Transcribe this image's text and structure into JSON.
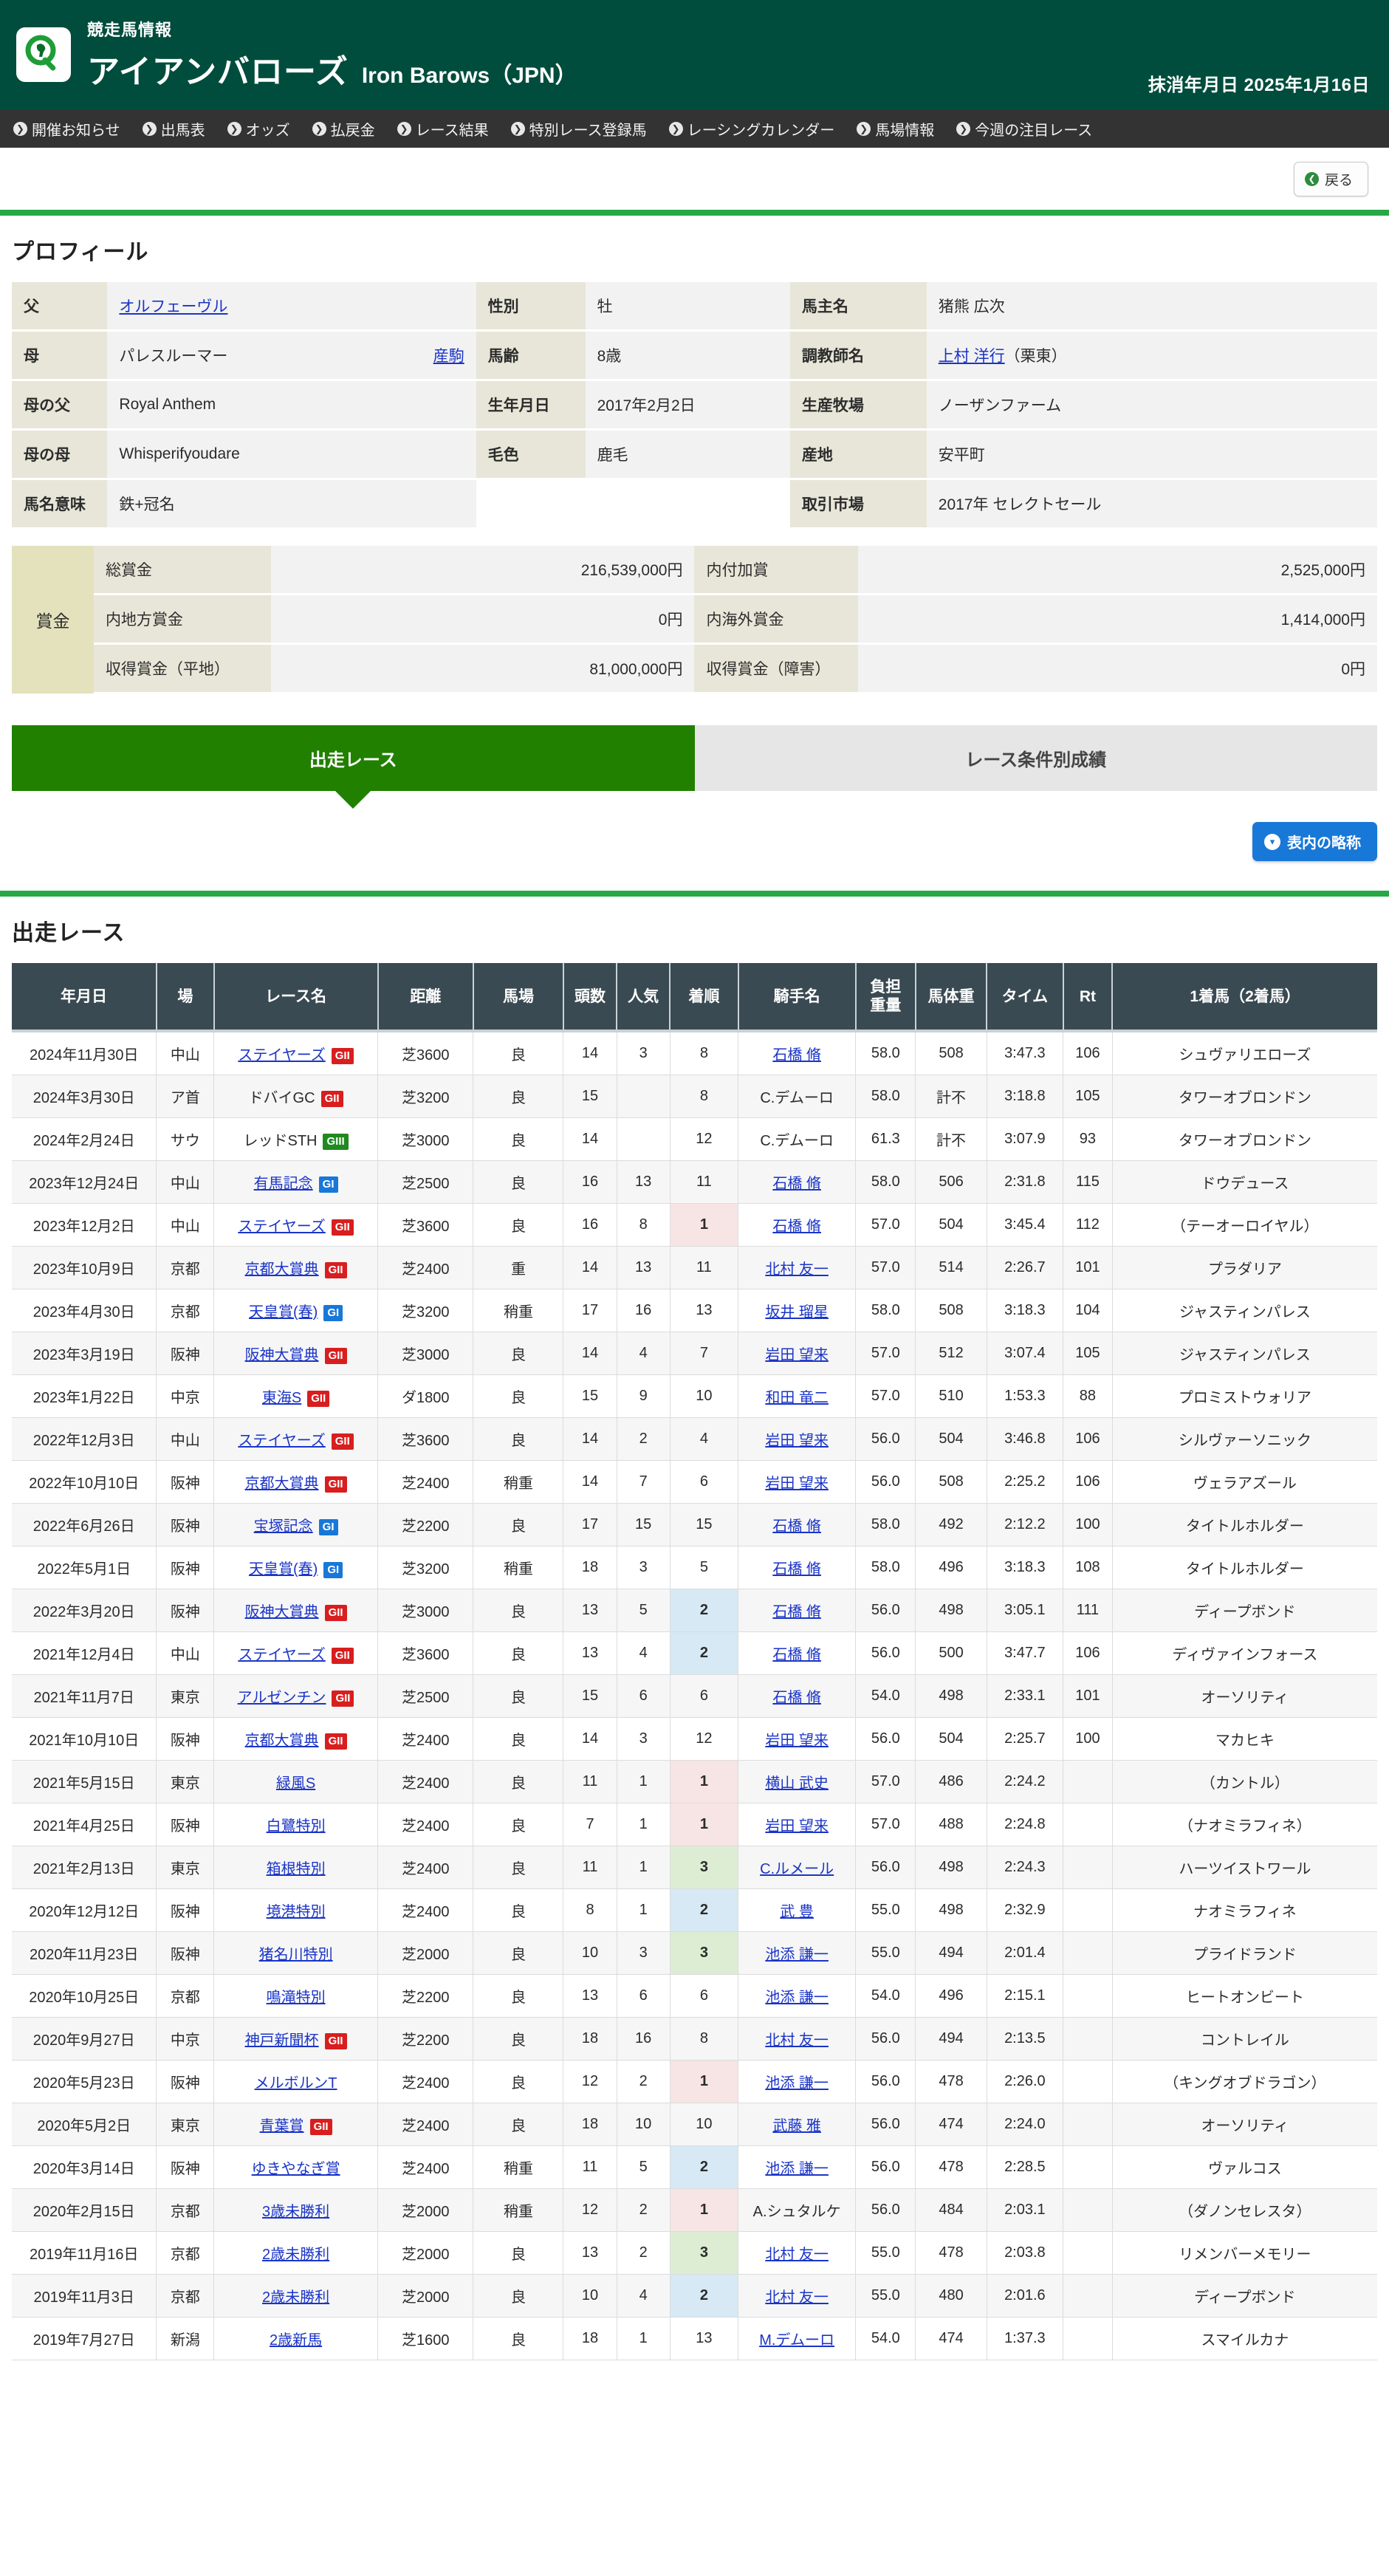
{
  "header": {
    "kicker": "競走馬情報",
    "horse_name_ja": "アイアンバローズ",
    "horse_name_en": "Iron Barows（JPN）",
    "erase_date": "抹消年月日 2025年1月16日",
    "logo_icon": "horse-magnifier-icon",
    "bg_color": "#004d3d"
  },
  "nav": {
    "items": [
      {
        "label": "開催お知らせ"
      },
      {
        "label": "出馬表"
      },
      {
        "label": "オッズ"
      },
      {
        "label": "払戻金"
      },
      {
        "label": "レース結果"
      },
      {
        "label": "特別レース登録馬"
      },
      {
        "label": "レーシングカレンダー"
      },
      {
        "label": "馬場情報"
      },
      {
        "label": "今週の注目レース"
      }
    ]
  },
  "back_button": {
    "label": "戻る",
    "icon": "back-arrow-icon"
  },
  "profile": {
    "section_title": "プロフィール",
    "rows": [
      {
        "l_label": "父",
        "l_value": "オルフェーヴル",
        "l_link": true,
        "l_sub": "",
        "r_label": "性別",
        "r_value": "牡",
        "x_label": "馬主名",
        "x_value": "猪熊 広次",
        "x_link": false,
        "x_suffix": ""
      },
      {
        "l_label": "母",
        "l_value": "パレスルーマー",
        "l_link": false,
        "l_sub": "産駒",
        "r_label": "馬齢",
        "r_value": "8歳",
        "x_label": "調教師名",
        "x_value": "上村 洋行",
        "x_link": true,
        "x_suffix": "（栗東）"
      },
      {
        "l_label": "母の父",
        "l_value": "Royal Anthem",
        "l_link": false,
        "l_sub": "",
        "r_label": "生年月日",
        "r_value": "2017年2月2日",
        "x_label": "生産牧場",
        "x_value": "ノーザンファーム",
        "x_link": false,
        "x_suffix": ""
      },
      {
        "l_label": "母の母",
        "l_value": "Whisperifyoudare",
        "l_link": false,
        "l_sub": "",
        "r_label": "毛色",
        "r_value": "鹿毛",
        "x_label": "産地",
        "x_value": "安平町",
        "x_link": false,
        "x_suffix": ""
      },
      {
        "l_label": "馬名意味",
        "l_value": "鉄+冠名",
        "l_link": false,
        "l_sub": "",
        "r_label": "",
        "r_value": "",
        "x_label": "取引市場",
        "x_value": "2017年 セレクトセール",
        "x_link": false,
        "x_suffix": ""
      }
    ]
  },
  "prize": {
    "head_label": "賞金",
    "rows": [
      {
        "l_label": "総賞金",
        "l_value": "216,539,000円",
        "r_label": "内付加賞",
        "r_value": "2,525,000円"
      },
      {
        "l_label": "内地方賞金",
        "l_value": "0円",
        "r_label": "内海外賞金",
        "r_value": "1,414,000円"
      },
      {
        "l_label": "収得賞金（平地）",
        "l_value": "81,000,000円",
        "r_label": "収得賞金（障害）",
        "r_value": "0円"
      }
    ]
  },
  "tabs": {
    "active": "出走レース",
    "inactive": "レース条件別成績"
  },
  "abbrev_button": {
    "label": "表内の略称",
    "icon": "chevron-down-circle-icon"
  },
  "race_section": {
    "title": "出走レース",
    "columns": [
      "年月日",
      "場",
      "レース名",
      "距離",
      "馬場",
      "頭数",
      "人気",
      "着順",
      "騎手名",
      "負担\n重量",
      "馬体重",
      "タイム",
      "Rt",
      "1着馬（2着馬）"
    ],
    "column_keys": [
      "date",
      "course",
      "race",
      "distance",
      "going",
      "field",
      "pop",
      "finish",
      "jockey",
      "weight",
      "horse_weight",
      "time",
      "rt",
      "winner"
    ],
    "rows": [
      {
        "date": "2024年11月30日",
        "course": "中山",
        "race": "ステイヤーズ",
        "race_link": true,
        "grade": "GII",
        "distance": "芝3600",
        "going": "良",
        "field": "14",
        "pop": "3",
        "finish": "8",
        "jockey": "石橋 脩",
        "jockey_link": true,
        "weight": "58.0",
        "horse_weight": "508",
        "time": "3:47.3",
        "rt": "106",
        "winner": "シュヴァリエローズ"
      },
      {
        "date": "2024年3月30日",
        "course": "ア首",
        "race": "ドバイGC",
        "race_link": false,
        "grade": "GII",
        "distance": "芝3200",
        "going": "良",
        "field": "15",
        "pop": "",
        "finish": "8",
        "jockey": "C.デムーロ",
        "jockey_link": false,
        "weight": "58.0",
        "horse_weight": "計不",
        "time": "3:18.8",
        "rt": "105",
        "winner": "タワーオブロンドン"
      },
      {
        "date": "2024年2月24日",
        "course": "サウ",
        "race": "レッドSTH",
        "race_link": false,
        "grade": "GIII",
        "distance": "芝3000",
        "going": "良",
        "field": "14",
        "pop": "",
        "finish": "12",
        "jockey": "C.デムーロ",
        "jockey_link": false,
        "weight": "61.3",
        "horse_weight": "計不",
        "time": "3:07.9",
        "rt": "93",
        "winner": "タワーオブロンドン"
      },
      {
        "date": "2023年12月24日",
        "course": "中山",
        "race": "有馬記念",
        "race_link": true,
        "grade": "GI",
        "distance": "芝2500",
        "going": "良",
        "field": "16",
        "pop": "13",
        "finish": "11",
        "jockey": "石橋 脩",
        "jockey_link": true,
        "weight": "58.0",
        "horse_weight": "506",
        "time": "2:31.8",
        "rt": "115",
        "winner": "ドウデュース"
      },
      {
        "date": "2023年12月2日",
        "course": "中山",
        "race": "ステイヤーズ",
        "race_link": true,
        "grade": "GII",
        "distance": "芝3600",
        "going": "良",
        "field": "16",
        "pop": "8",
        "finish": "1",
        "jockey": "石橋 脩",
        "jockey_link": true,
        "weight": "57.0",
        "horse_weight": "504",
        "time": "3:45.4",
        "rt": "112",
        "winner": "（テーオーロイヤル）"
      },
      {
        "date": "2023年10月9日",
        "course": "京都",
        "race": "京都大賞典",
        "race_link": true,
        "grade": "GII",
        "distance": "芝2400",
        "going": "重",
        "field": "14",
        "pop": "13",
        "finish": "11",
        "jockey": "北村 友一",
        "jockey_link": true,
        "weight": "57.0",
        "horse_weight": "514",
        "time": "2:26.7",
        "rt": "101",
        "winner": "プラダリア"
      },
      {
        "date": "2023年4月30日",
        "course": "京都",
        "race": "天皇賞(春)",
        "race_link": true,
        "grade": "GI",
        "distance": "芝3200",
        "going": "稍重",
        "field": "17",
        "pop": "16",
        "finish": "13",
        "jockey": "坂井 瑠星",
        "jockey_link": true,
        "weight": "58.0",
        "horse_weight": "508",
        "time": "3:18.3",
        "rt": "104",
        "winner": "ジャスティンパレス"
      },
      {
        "date": "2023年3月19日",
        "course": "阪神",
        "race": "阪神大賞典",
        "race_link": true,
        "grade": "GII",
        "distance": "芝3000",
        "going": "良",
        "field": "14",
        "pop": "4",
        "finish": "7",
        "jockey": "岩田 望来",
        "jockey_link": true,
        "weight": "57.0",
        "horse_weight": "512",
        "time": "3:07.4",
        "rt": "105",
        "winner": "ジャスティンパレス"
      },
      {
        "date": "2023年1月22日",
        "course": "中京",
        "race": "東海S",
        "race_link": true,
        "grade": "GII",
        "distance": "ダ1800",
        "going": "良",
        "field": "15",
        "pop": "9",
        "finish": "10",
        "jockey": "和田 竜二",
        "jockey_link": true,
        "weight": "57.0",
        "horse_weight": "510",
        "time": "1:53.3",
        "rt": "88",
        "winner": "プロミストウォリア"
      },
      {
        "date": "2022年12月3日",
        "course": "中山",
        "race": "ステイヤーズ",
        "race_link": true,
        "grade": "GII",
        "distance": "芝3600",
        "going": "良",
        "field": "14",
        "pop": "2",
        "finish": "4",
        "jockey": "岩田 望来",
        "jockey_link": true,
        "weight": "56.0",
        "horse_weight": "504",
        "time": "3:46.8",
        "rt": "106",
        "winner": "シルヴァーソニック"
      },
      {
        "date": "2022年10月10日",
        "course": "阪神",
        "race": "京都大賞典",
        "race_link": true,
        "grade": "GII",
        "distance": "芝2400",
        "going": "稍重",
        "field": "14",
        "pop": "7",
        "finish": "6",
        "jockey": "岩田 望来",
        "jockey_link": true,
        "weight": "56.0",
        "horse_weight": "508",
        "time": "2:25.2",
        "rt": "106",
        "winner": "ヴェラアズール"
      },
      {
        "date": "2022年6月26日",
        "course": "阪神",
        "race": "宝塚記念",
        "race_link": true,
        "grade": "GI",
        "distance": "芝2200",
        "going": "良",
        "field": "17",
        "pop": "15",
        "finish": "15",
        "jockey": "石橋 脩",
        "jockey_link": true,
        "weight": "58.0",
        "horse_weight": "492",
        "time": "2:12.2",
        "rt": "100",
        "winner": "タイトルホルダー"
      },
      {
        "date": "2022年5月1日",
        "course": "阪神",
        "race": "天皇賞(春)",
        "race_link": true,
        "grade": "GI",
        "distance": "芝3200",
        "going": "稍重",
        "field": "18",
        "pop": "3",
        "finish": "5",
        "jockey": "石橋 脩",
        "jockey_link": true,
        "weight": "58.0",
        "horse_weight": "496",
        "time": "3:18.3",
        "rt": "108",
        "winner": "タイトルホルダー"
      },
      {
        "date": "2022年3月20日",
        "course": "阪神",
        "race": "阪神大賞典",
        "race_link": true,
        "grade": "GII",
        "distance": "芝3000",
        "going": "良",
        "field": "13",
        "pop": "5",
        "finish": "2",
        "jockey": "石橋 脩",
        "jockey_link": true,
        "weight": "56.0",
        "horse_weight": "498",
        "time": "3:05.1",
        "rt": "111",
        "winner": "ディープボンド"
      },
      {
        "date": "2021年12月4日",
        "course": "中山",
        "race": "ステイヤーズ",
        "race_link": true,
        "grade": "GII",
        "distance": "芝3600",
        "going": "良",
        "field": "13",
        "pop": "4",
        "finish": "2",
        "jockey": "石橋 脩",
        "jockey_link": true,
        "weight": "56.0",
        "horse_weight": "500",
        "time": "3:47.7",
        "rt": "106",
        "winner": "ディヴァインフォース"
      },
      {
        "date": "2021年11月7日",
        "course": "東京",
        "race": "アルゼンチン",
        "race_link": true,
        "grade": "GII",
        "distance": "芝2500",
        "going": "良",
        "field": "15",
        "pop": "6",
        "finish": "6",
        "jockey": "石橋 脩",
        "jockey_link": true,
        "weight": "54.0",
        "horse_weight": "498",
        "time": "2:33.1",
        "rt": "101",
        "winner": "オーソリティ"
      },
      {
        "date": "2021年10月10日",
        "course": "阪神",
        "race": "京都大賞典",
        "race_link": true,
        "grade": "GII",
        "distance": "芝2400",
        "going": "良",
        "field": "14",
        "pop": "3",
        "finish": "12",
        "jockey": "岩田 望来",
        "jockey_link": true,
        "weight": "56.0",
        "horse_weight": "504",
        "time": "2:25.7",
        "rt": "100",
        "winner": "マカヒキ"
      },
      {
        "date": "2021年5月15日",
        "course": "東京",
        "race": "緑風S",
        "race_link": true,
        "grade": "",
        "distance": "芝2400",
        "going": "良",
        "field": "11",
        "pop": "1",
        "finish": "1",
        "jockey": "横山 武史",
        "jockey_link": true,
        "weight": "57.0",
        "horse_weight": "486",
        "time": "2:24.2",
        "rt": "",
        "winner": "（カントル）"
      },
      {
        "date": "2021年4月25日",
        "course": "阪神",
        "race": "白鷺特別",
        "race_link": true,
        "grade": "",
        "distance": "芝2400",
        "going": "良",
        "field": "7",
        "pop": "1",
        "finish": "1",
        "jockey": "岩田 望来",
        "jockey_link": true,
        "weight": "57.0",
        "horse_weight": "488",
        "time": "2:24.8",
        "rt": "",
        "winner": "（ナオミラフィネ）"
      },
      {
        "date": "2021年2月13日",
        "course": "東京",
        "race": "箱根特別",
        "race_link": true,
        "grade": "",
        "distance": "芝2400",
        "going": "良",
        "field": "11",
        "pop": "1",
        "finish": "3",
        "jockey": "C.ルメール",
        "jockey_link": true,
        "weight": "56.0",
        "horse_weight": "498",
        "time": "2:24.3",
        "rt": "",
        "winner": "ハーツイストワール"
      },
      {
        "date": "2020年12月12日",
        "course": "阪神",
        "race": "境港特別",
        "race_link": true,
        "grade": "",
        "distance": "芝2400",
        "going": "良",
        "field": "8",
        "pop": "1",
        "finish": "2",
        "jockey": "武 豊",
        "jockey_link": true,
        "weight": "55.0",
        "horse_weight": "498",
        "time": "2:32.9",
        "rt": "",
        "winner": "ナオミラフィネ"
      },
      {
        "date": "2020年11月23日",
        "course": "阪神",
        "race": "猪名川特別",
        "race_link": true,
        "grade": "",
        "distance": "芝2000",
        "going": "良",
        "field": "10",
        "pop": "3",
        "finish": "3",
        "jockey": "池添 謙一",
        "jockey_link": true,
        "weight": "55.0",
        "horse_weight": "494",
        "time": "2:01.4",
        "rt": "",
        "winner": "プライドランド"
      },
      {
        "date": "2020年10月25日",
        "course": "京都",
        "race": "鳴滝特別",
        "race_link": true,
        "grade": "",
        "distance": "芝2200",
        "going": "良",
        "field": "13",
        "pop": "6",
        "finish": "6",
        "jockey": "池添 謙一",
        "jockey_link": true,
        "weight": "54.0",
        "horse_weight": "496",
        "time": "2:15.1",
        "rt": "",
        "winner": "ヒートオンビート"
      },
      {
        "date": "2020年9月27日",
        "course": "中京",
        "race": "神戸新聞杯",
        "race_link": true,
        "grade": "GII",
        "distance": "芝2200",
        "going": "良",
        "field": "18",
        "pop": "16",
        "finish": "8",
        "jockey": "北村 友一",
        "jockey_link": true,
        "weight": "56.0",
        "horse_weight": "494",
        "time": "2:13.5",
        "rt": "",
        "winner": "コントレイル"
      },
      {
        "date": "2020年5月23日",
        "course": "阪神",
        "race": "メルボルンT",
        "race_link": true,
        "grade": "",
        "distance": "芝2400",
        "going": "良",
        "field": "12",
        "pop": "2",
        "finish": "1",
        "jockey": "池添 謙一",
        "jockey_link": true,
        "weight": "56.0",
        "horse_weight": "478",
        "time": "2:26.0",
        "rt": "",
        "winner": "（キングオブドラゴン）"
      },
      {
        "date": "2020年5月2日",
        "course": "東京",
        "race": "青葉賞",
        "race_link": true,
        "grade": "GII",
        "distance": "芝2400",
        "going": "良",
        "field": "18",
        "pop": "10",
        "finish": "10",
        "jockey": "武藤 雅",
        "jockey_link": true,
        "weight": "56.0",
        "horse_weight": "474",
        "time": "2:24.0",
        "rt": "",
        "winner": "オーソリティ"
      },
      {
        "date": "2020年3月14日",
        "course": "阪神",
        "race": "ゆきやなぎ賞",
        "race_link": true,
        "grade": "",
        "distance": "芝2400",
        "going": "稍重",
        "field": "11",
        "pop": "5",
        "finish": "2",
        "jockey": "池添 謙一",
        "jockey_link": true,
        "weight": "56.0",
        "horse_weight": "478",
        "time": "2:28.5",
        "rt": "",
        "winner": "ヴァルコス"
      },
      {
        "date": "2020年2月15日",
        "course": "京都",
        "race": "3歳未勝利",
        "race_link": true,
        "grade": "",
        "distance": "芝2000",
        "going": "稍重",
        "field": "12",
        "pop": "2",
        "finish": "1",
        "jockey": "A.シュタルケ",
        "jockey_link": false,
        "weight": "56.0",
        "horse_weight": "484",
        "time": "2:03.1",
        "rt": "",
        "winner": "（ダノンセレスタ）"
      },
      {
        "date": "2019年11月16日",
        "course": "京都",
        "race": "2歳未勝利",
        "race_link": true,
        "grade": "",
        "distance": "芝2000",
        "going": "良",
        "field": "13",
        "pop": "2",
        "finish": "3",
        "jockey": "北村 友一",
        "jockey_link": true,
        "weight": "55.0",
        "horse_weight": "478",
        "time": "2:03.8",
        "rt": "",
        "winner": "リメンバーメモリー"
      },
      {
        "date": "2019年11月3日",
        "course": "京都",
        "race": "2歳未勝利",
        "race_link": true,
        "grade": "",
        "distance": "芝2000",
        "going": "良",
        "field": "10",
        "pop": "4",
        "finish": "2",
        "jockey": "北村 友一",
        "jockey_link": true,
        "weight": "55.0",
        "horse_weight": "480",
        "time": "2:01.6",
        "rt": "",
        "winner": "ディープボンド"
      },
      {
        "date": "2019年7月27日",
        "course": "新潟",
        "race": "2歳新馬",
        "race_link": true,
        "grade": "",
        "distance": "芝1600",
        "going": "良",
        "field": "18",
        "pop": "1",
        "finish": "13",
        "jockey": "M.デムーロ",
        "jockey_link": true,
        "weight": "54.0",
        "horse_weight": "474",
        "time": "1:37.3",
        "rt": "",
        "winner": "スマイルカナ"
      }
    ]
  },
  "colors": {
    "header_green": "#004d3d",
    "accent_green": "#27a844",
    "tab_active": "#218000",
    "nav_dark": "#333333",
    "table_head": "#3a4a52",
    "badge_g1": "#1878d8",
    "badge_g2": "#d81e1e",
    "badge_g3": "#1f8a1f",
    "pos1_bg": "#f7e4e4",
    "pos2_bg": "#d6e9f5",
    "pos3_bg": "#dcedd3"
  }
}
